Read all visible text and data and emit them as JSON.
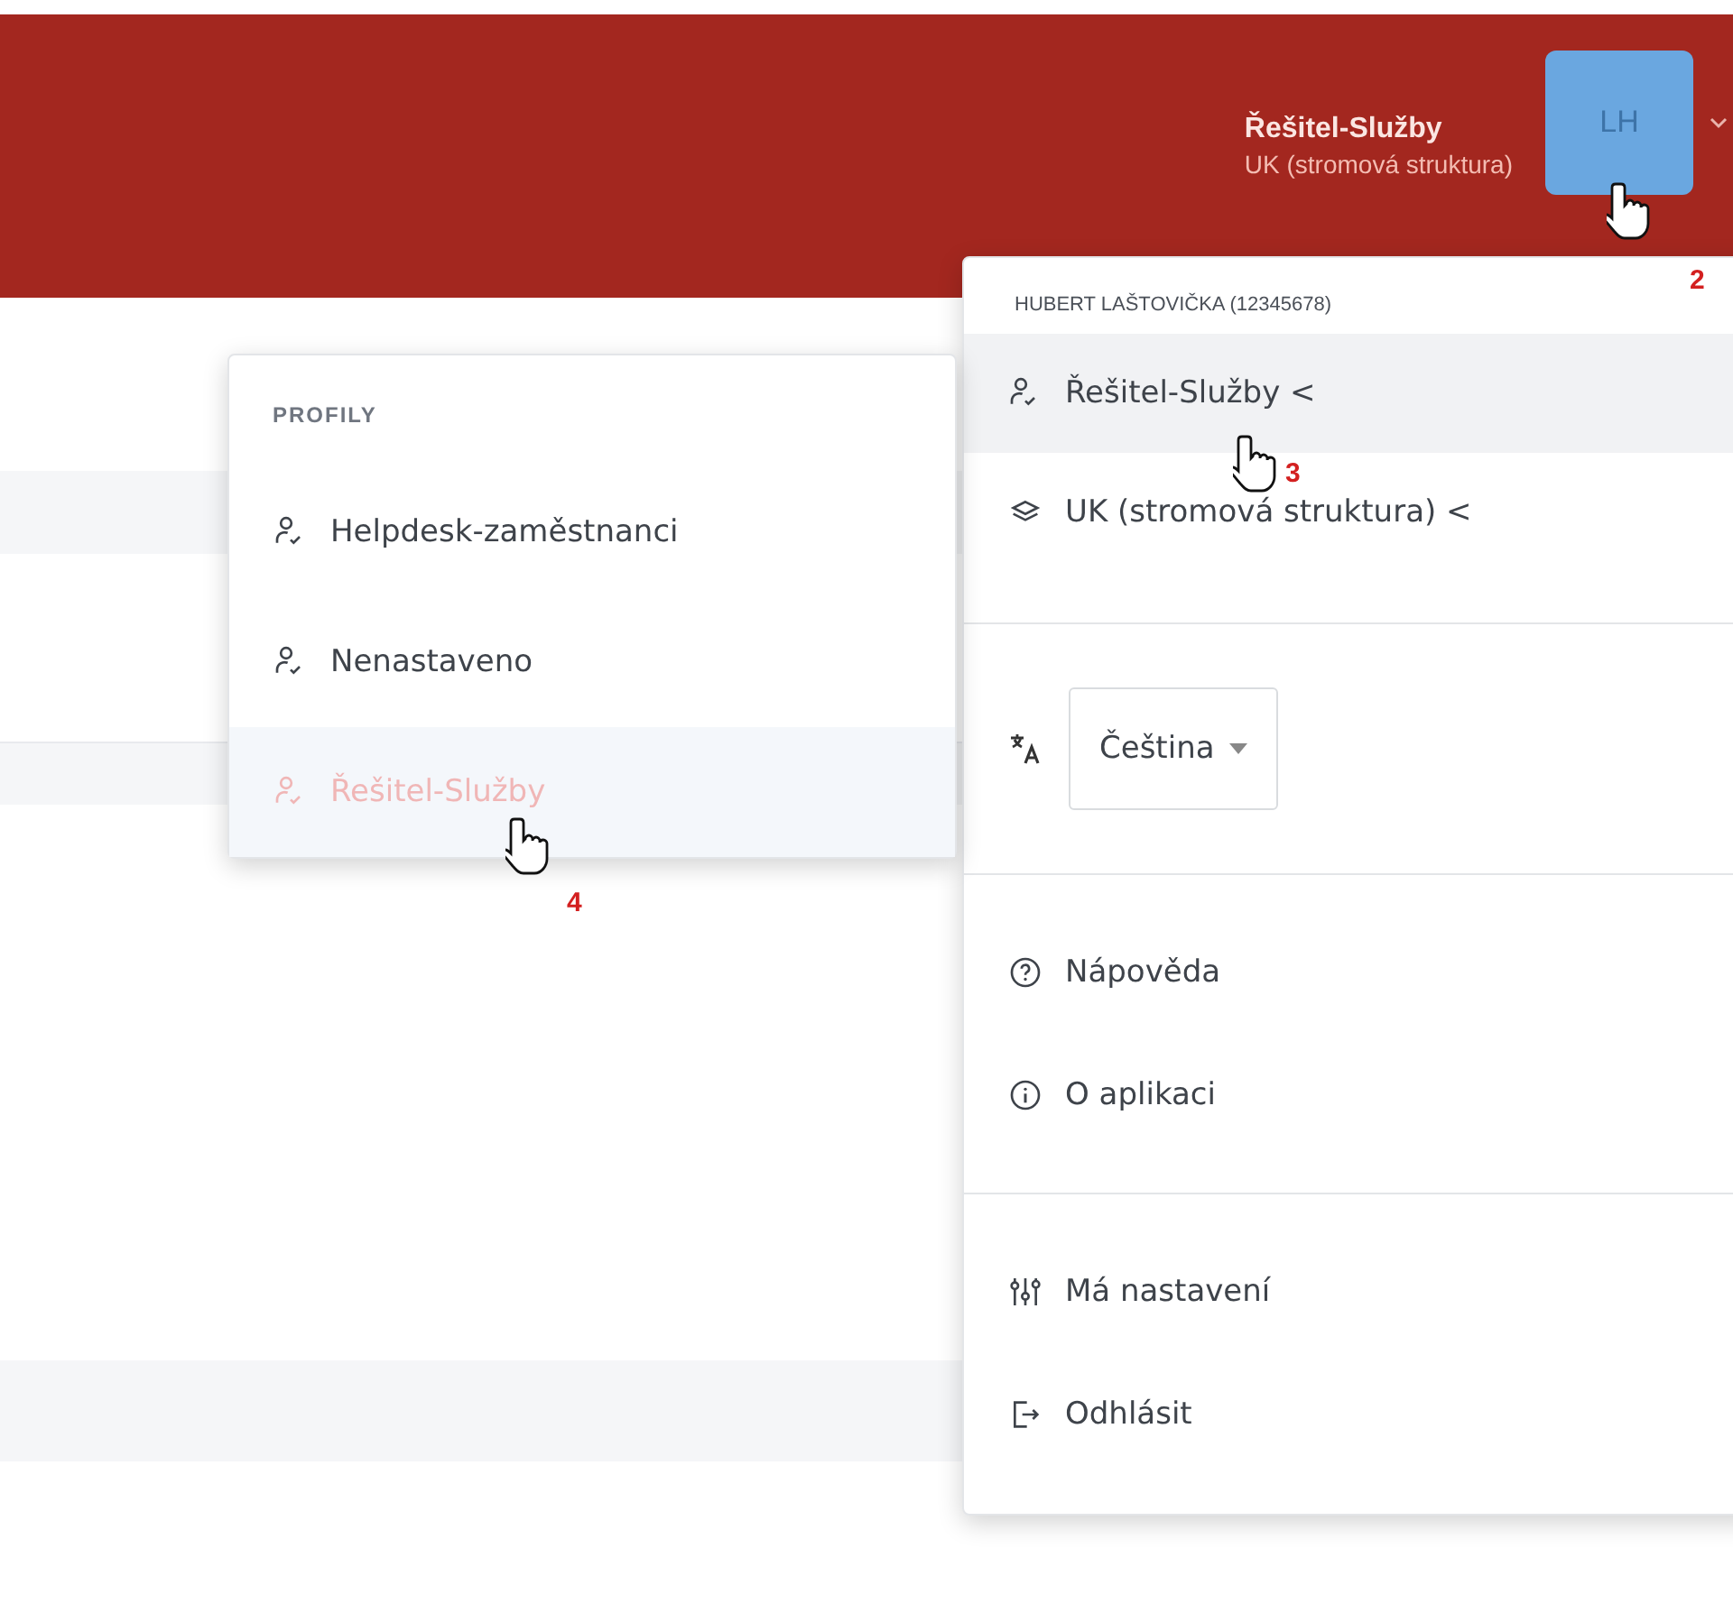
{
  "header": {
    "role": "Řešitel-Služby",
    "unit": "UK (stromová struktura)",
    "avatar": "LH"
  },
  "user_menu": {
    "user": "HUBERT LAŠTOVIČKA (12345678)",
    "context_items": [
      {
        "kind": "profile",
        "label": "Řešitel-Služby",
        "arrow": "<",
        "selected": true
      },
      {
        "kind": "unit",
        "label": "UK (stromová struktura)",
        "arrow": "<",
        "selected": false
      }
    ],
    "language": {
      "value": "Čeština"
    },
    "info_items": [
      {
        "kind": "help",
        "label": "Nápověda"
      },
      {
        "kind": "about",
        "label": "O aplikaci"
      }
    ],
    "account_items": [
      {
        "kind": "settings",
        "label": "Má nastavení"
      },
      {
        "kind": "logout",
        "label": "Odhlásit"
      }
    ]
  },
  "profiles_menu": {
    "title": "PROFILY",
    "items": [
      {
        "label": "Helpdesk-zaměstnanci",
        "selected": false
      },
      {
        "label": "Nenastaveno",
        "selected": false
      },
      {
        "label": "Řešitel-Služby",
        "selected": true
      }
    ]
  },
  "annotations": [
    {
      "kind": "cursor",
      "step": "2"
    },
    {
      "kind": "cursor",
      "step": "3"
    },
    {
      "kind": "cursor",
      "step": "4"
    }
  ]
}
